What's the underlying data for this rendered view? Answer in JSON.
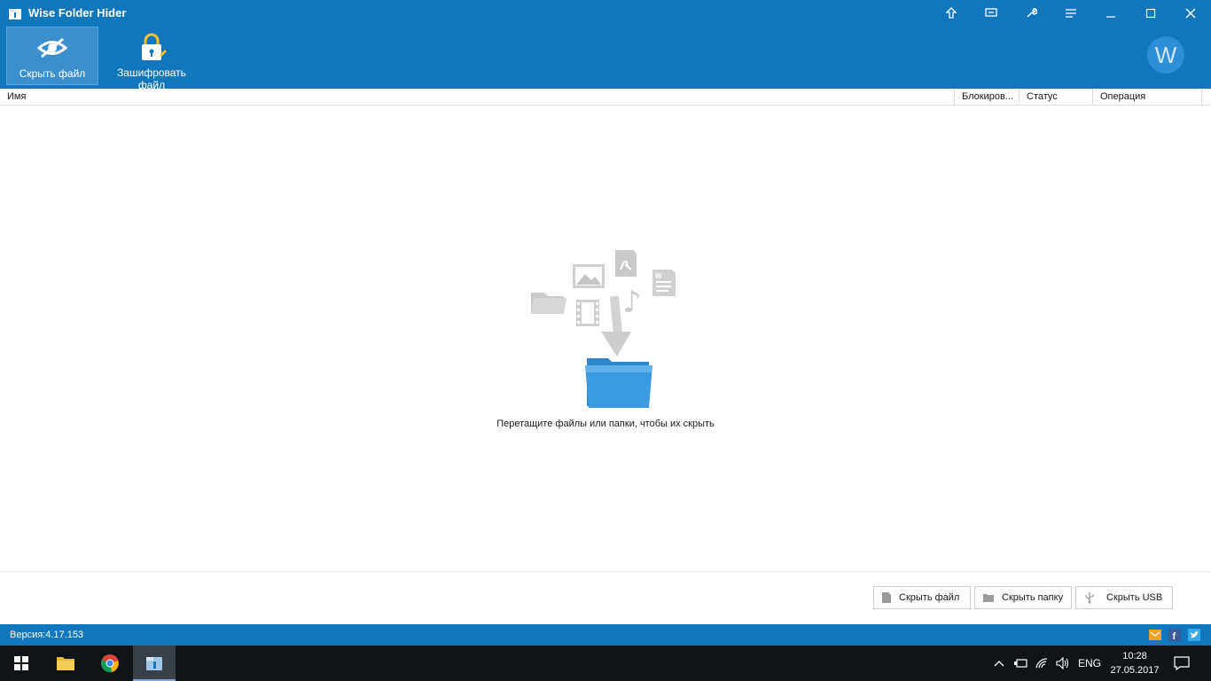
{
  "app": {
    "title": "Wise Folder Hider"
  },
  "toolbar": {
    "hide_file": "Скрыть файл",
    "encrypt_file": "Зашифровать файл",
    "avatar_letter": "W"
  },
  "columns": [
    "Имя",
    "Блокиров...",
    "Статус",
    "Операция"
  ],
  "empty_state": {
    "message": "Перетащите файлы или папки, чтобы их скрыть"
  },
  "bottom_buttons": {
    "hide_file": "Скрыть файл",
    "hide_folder": "Скрыть папку",
    "hide_usb": "Скрыть USB"
  },
  "status": {
    "version": "Версия:4.17.153"
  },
  "taskbar": {
    "lang": "ENG",
    "time": "10:28",
    "date": "27.05.2017"
  },
  "colors": {
    "accent": "#1176bc",
    "folder": "#3b9be0"
  }
}
